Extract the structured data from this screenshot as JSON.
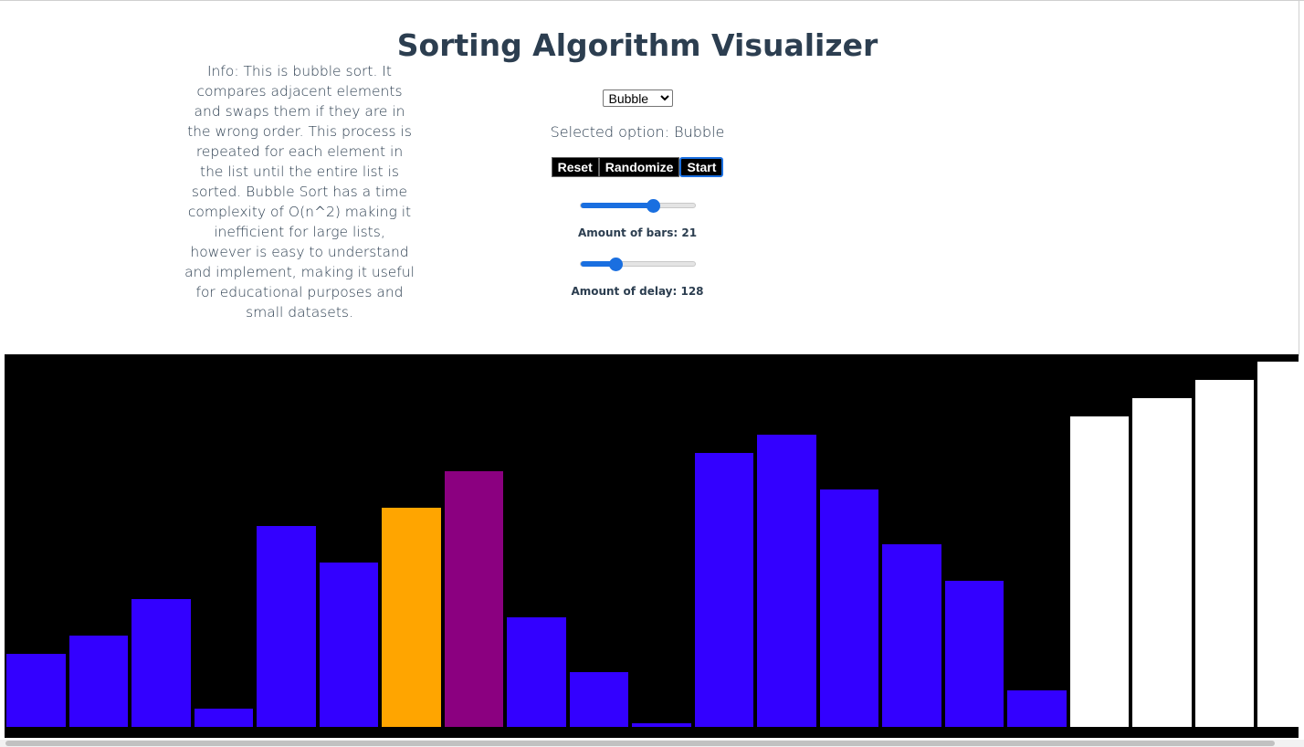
{
  "title": "Sorting Algorithm Visualizer",
  "info": "Info: This is bubble sort. It compares adjacent elements and swaps them if they are in the wrong order. This process is repeated for each element in the list until the entire list is sorted. Bubble Sort has a time complexity of O(n^2) making it inefficient for large lists, however is easy to understand and implement, making it useful for educational purposes and small datasets.",
  "algorithm_select": {
    "selected": "Bubble"
  },
  "selected_option_text": "Selected option: Bubble",
  "buttons": {
    "reset": "Reset",
    "randomize": "Randomize",
    "start": "Start"
  },
  "bars_slider": {
    "label": "Amount of bars: 21",
    "value": 21,
    "fraction": 0.64
  },
  "delay_slider": {
    "label": "Amount of delay: 128",
    "value": 128,
    "fraction": 0.28
  },
  "colors": {
    "unsorted": "#3300ff",
    "comparing": "#ffa500",
    "swapping": "#8b0080",
    "sorted": "#ffffff",
    "background": "#000000"
  },
  "chart_data": {
    "type": "bar",
    "values": [
      4,
      5,
      7,
      1,
      11,
      9,
      12,
      14,
      6,
      3,
      0.2,
      15,
      16,
      13,
      10,
      8,
      2,
      17,
      18,
      19,
      20
    ],
    "states": [
      "unsorted",
      "unsorted",
      "unsorted",
      "unsorted",
      "unsorted",
      "unsorted",
      "comparing",
      "swapping",
      "unsorted",
      "unsorted",
      "unsorted",
      "unsorted",
      "unsorted",
      "unsorted",
      "unsorted",
      "unsorted",
      "unsorted",
      "sorted",
      "sorted",
      "sorted",
      "sorted"
    ],
    "ylim": [
      0,
      21
    ]
  }
}
